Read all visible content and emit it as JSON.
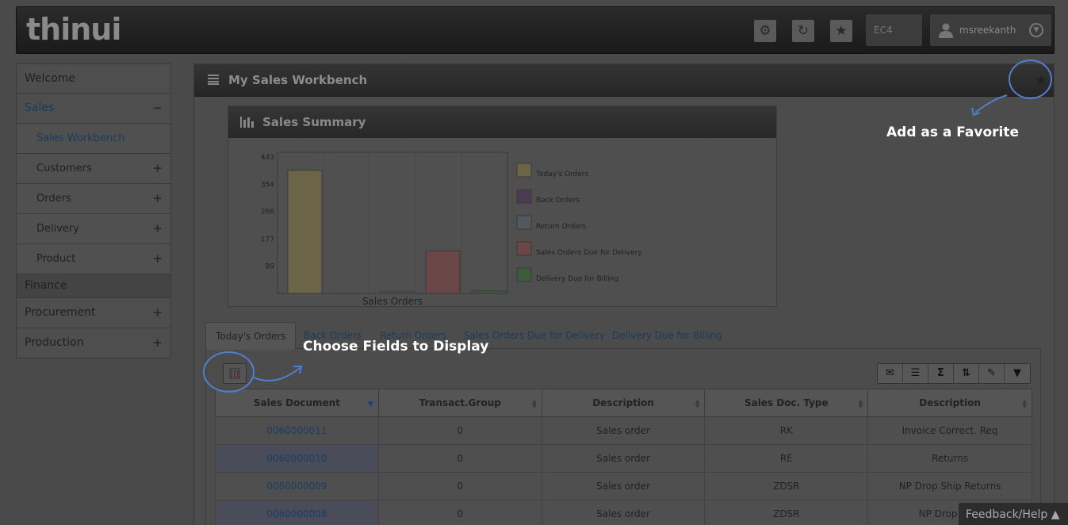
{
  "header": {
    "logo": "thinui",
    "environment": "EC4",
    "username": "msreekanth",
    "icons": [
      "gear-icon",
      "refresh-icon",
      "star-icon"
    ]
  },
  "sidebar": {
    "items": [
      {
        "label": "Welcome",
        "level": 0,
        "toggle": ""
      },
      {
        "label": "Sales",
        "level": 0,
        "toggle": "−",
        "active": true
      },
      {
        "label": "Sales Workbench",
        "level": 1,
        "toggle": "",
        "active": true
      },
      {
        "label": "Customers",
        "level": 1,
        "toggle": "+"
      },
      {
        "label": "Orders",
        "level": 1,
        "toggle": "+"
      },
      {
        "label": "Delivery",
        "level": 1,
        "toggle": "+"
      },
      {
        "label": "Product",
        "level": 1,
        "toggle": "+"
      },
      {
        "label": "Finance",
        "level": 0,
        "toggle": ""
      },
      {
        "label": "Procurement",
        "level": 0,
        "toggle": "+"
      },
      {
        "label": "Production",
        "level": 0,
        "toggle": "+"
      }
    ]
  },
  "main": {
    "title": "My Sales Workbench"
  },
  "summary": {
    "title": "Sales Summary"
  },
  "chart_data": {
    "type": "bar",
    "title": "",
    "xlabel": "Sales Orders",
    "ylabel": "",
    "yticks": [
      "443",
      "354",
      "266",
      "177",
      "89"
    ],
    "ylim": [
      0,
      443
    ],
    "categories": [
      "Today's Orders",
      "Back Orders",
      "Return Orders",
      "Sales Orders Due for Delivery",
      "Delivery Due for Billing"
    ],
    "values": [
      400,
      0,
      5,
      138,
      8
    ],
    "colors": [
      "#6b6446",
      "#4c3a52",
      "#53585e",
      "#6a4646",
      "#3d5a3d"
    ],
    "legend": [
      "Today's Orders",
      "Back Orders",
      "Return Orders",
      "Sales Orders Due for Delivery",
      "Delivery Due for Billing"
    ],
    "legend_position": "right"
  },
  "tabs": [
    {
      "label": "Today's Orders",
      "active": true
    },
    {
      "label": "Back Orders"
    },
    {
      "label": "Return Orders"
    },
    {
      "label": "Sales Orders Due for Delivery"
    },
    {
      "label": "Delivery Due for Billing"
    }
  ],
  "toolbar": {
    "tools": [
      "email-icon",
      "list-icon",
      "sum-icon",
      "sort-icon",
      "export-icon",
      "filter-icon"
    ],
    "tool_glyphs": [
      "✉",
      "☰",
      "Σ",
      "⇅",
      "✎",
      "▼"
    ]
  },
  "table": {
    "columns": [
      "Sales Document",
      "Transact.Group",
      "Description",
      "Sales Doc. Type",
      "Description"
    ],
    "rows": [
      [
        "0060000011",
        "0",
        "Sales order",
        "RK",
        "Invoice Correct. Req"
      ],
      [
        "0060000010",
        "0",
        "Sales order",
        "RE",
        "Returns"
      ],
      [
        "0060000009",
        "0",
        "Sales order",
        "ZDSR",
        "NP Drop Ship Returns"
      ],
      [
        "0060000008",
        "0",
        "Sales order",
        "ZDSR",
        "NP Drop Ship"
      ]
    ]
  },
  "callouts": {
    "favorite": "Add as a Favorite",
    "fields": "Choose Fields to Display"
  },
  "feedback": "Feedback/Help"
}
